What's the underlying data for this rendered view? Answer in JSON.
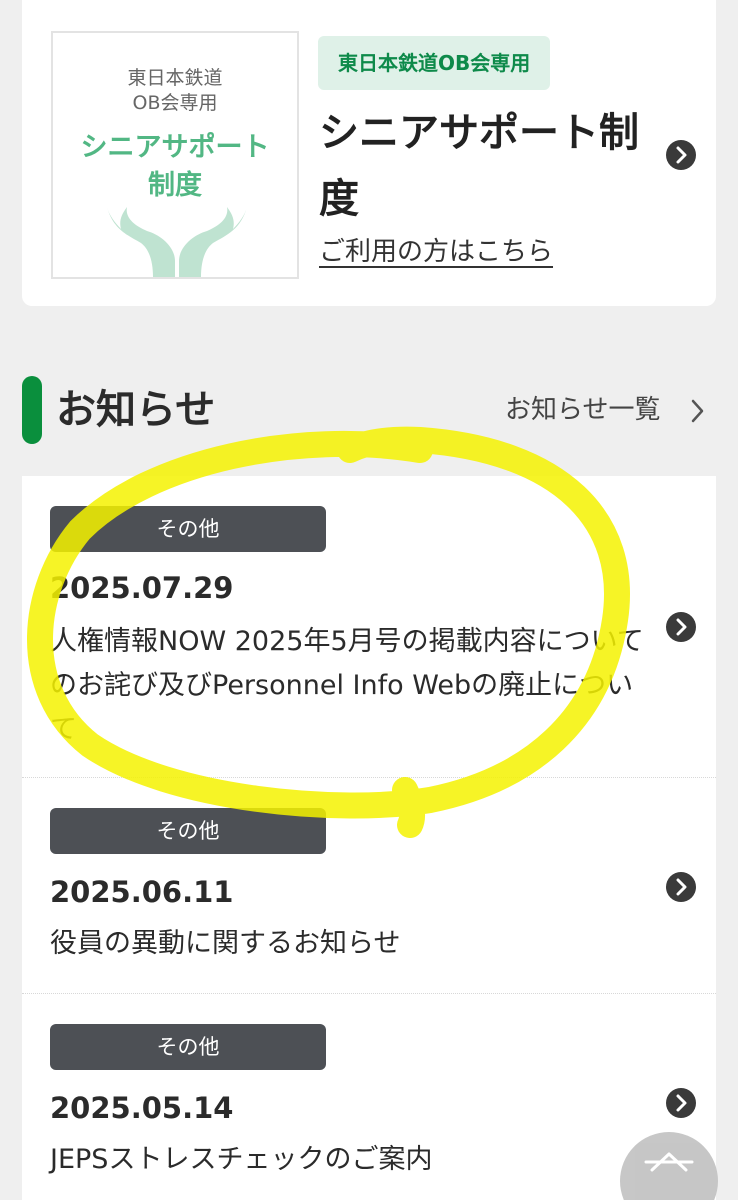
{
  "support": {
    "thumb_line1": "東日本鉄道",
    "thumb_line2": "OB会専用",
    "thumb_title1": "シニアサポート",
    "thumb_title2": "制度",
    "tag": "東日本鉄道OB会専用",
    "title": "シニアサポート制度",
    "link": "ご利用の方はこちら"
  },
  "news": {
    "heading": "お知らせ",
    "view_all": "お知らせ一覧",
    "items": [
      {
        "category": "その他",
        "date": "2025.07.29",
        "text": "人権情報NOW 2025年5月号の掲載内容についてのお詫び及びPersonnel Info Webの廃止について"
      },
      {
        "category": "その他",
        "date": "2025.06.11",
        "text": "役員の異動に関するお知らせ"
      },
      {
        "category": "その他",
        "date": "2025.05.14",
        "text": "JEPSストレスチェックのご案内"
      }
    ]
  },
  "colors": {
    "accent_green": "#0a8f3d",
    "tag_bg": "#dff1e8",
    "badge_bg": "#4d5055",
    "highlight": "#f4f200"
  }
}
